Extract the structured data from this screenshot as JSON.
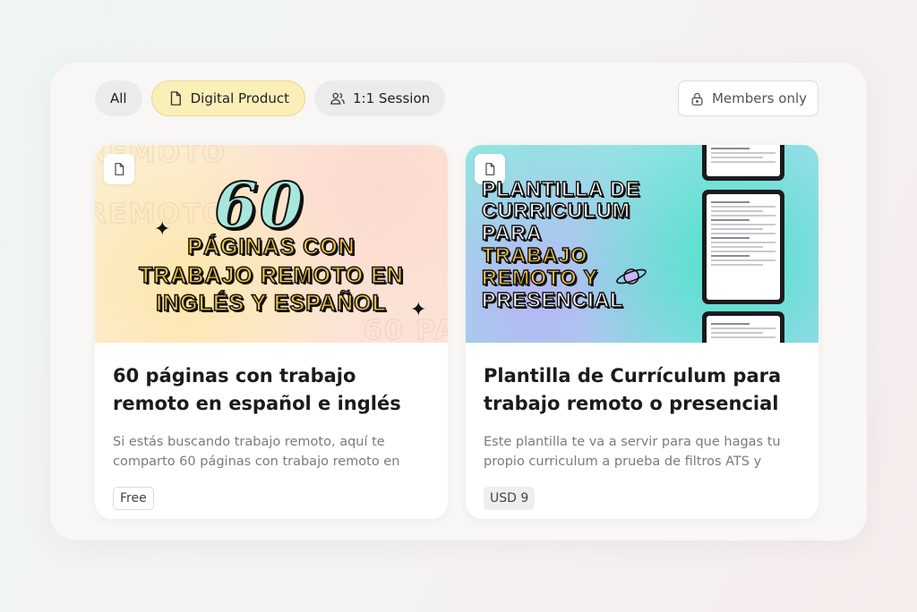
{
  "filters": {
    "all": "All",
    "digital_product": "Digital Product",
    "session": "1:1 Session"
  },
  "members_only": "Members only",
  "products": [
    {
      "banner": {
        "number": "60",
        "lines": [
          "PÁGINAS CON",
          "TRABAJO REMOTO EN",
          "INGLÉS Y ESPAÑOL"
        ]
      },
      "title": "60 páginas con trabajo remoto en español e inglés",
      "description": "Si estás buscando trabajo remoto, aquí te comparto 60 páginas con trabajo remoto en",
      "price": "Free"
    },
    {
      "banner": {
        "lines": [
          "PLANTILLA DE",
          "CURRICULUM",
          "PARA",
          "TRABAJO",
          "REMOTO Y",
          "PRESENCIAL"
        ]
      },
      "title": "Plantilla de Currículum para trabajo remoto o presencial",
      "description": "Este plantilla te va a servir para que hagas tu propio curriculum a prueba de filtros ATS y",
      "price": "USD 9"
    }
  ],
  "colors": {
    "active_chip": "#fbefb8",
    "banner_yellow": "#f5c542",
    "banner_teal": "#a6e7dd"
  },
  "icons": [
    "file-icon",
    "users-icon",
    "lock-icon",
    "sparkle-icon",
    "orbit-icon"
  ]
}
